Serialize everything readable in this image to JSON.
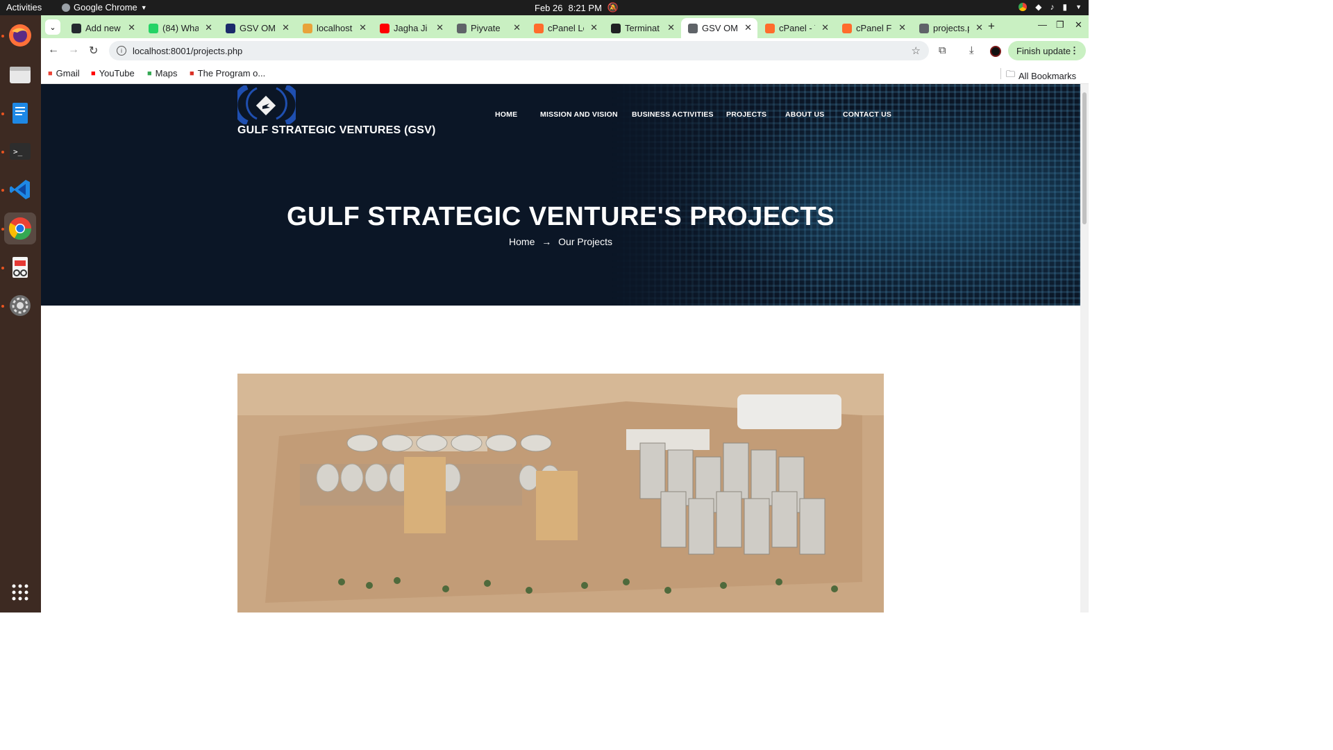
{
  "system_bar": {
    "activities": "Activities",
    "app_name": "Google Chrome",
    "date": "Feb 26",
    "time": "8:21 PM"
  },
  "dock": {
    "items": [
      "firefox-icon",
      "files-icon",
      "text-editor-icon",
      "terminal-icon",
      "vscode-icon",
      "chrome-icon",
      "document-viewer-icon",
      "settings-icon",
      "app-grid-icon"
    ]
  },
  "browser": {
    "tabs": [
      {
        "title": "Add new",
        "icon": "github-icon",
        "color": "#24292f"
      },
      {
        "title": "(84) Wha",
        "icon": "whatsapp-icon",
        "color": "#25d366"
      },
      {
        "title": "GSV OMA",
        "icon": "site-favicon",
        "color": "#1b2a6b"
      },
      {
        "title": "localhost",
        "icon": "localhost-icon",
        "color": "#e8a33b"
      },
      {
        "title": "Jagha Ji L",
        "icon": "youtube-icon",
        "color": "#ff0000"
      },
      {
        "title": "Piyvate",
        "icon": "globe-icon",
        "color": "#5f6368"
      },
      {
        "title": "cPanel Lo",
        "icon": "cpanel-icon",
        "color": "#ff6c2c"
      },
      {
        "title": "Terminat",
        "icon": "openai-icon",
        "color": "#202124"
      },
      {
        "title": "GSV OMA",
        "icon": "globe-icon",
        "color": "#5f6368",
        "active": true
      },
      {
        "title": "cPanel - T",
        "icon": "cpanel-icon",
        "color": "#ff6c2c"
      },
      {
        "title": "cPanel Fil",
        "icon": "cpanel-icon",
        "color": "#ff6c2c"
      },
      {
        "title": "projects.p",
        "icon": "globe-icon",
        "color": "#5f6368"
      }
    ],
    "url": "localhost:8001/projects.php",
    "update_label": "Finish update",
    "bookmarks": [
      {
        "label": "Gmail",
        "icon": "gmail-icon",
        "color": "#ea4335"
      },
      {
        "label": "YouTube",
        "icon": "youtube-icon",
        "color": "#ff0000"
      },
      {
        "label": "Maps",
        "icon": "maps-icon",
        "color": "#34a853"
      },
      {
        "label": "The Program o...",
        "icon": "program-icon",
        "color": "#d93025"
      }
    ],
    "all_bookmarks": "All Bookmarks",
    "accent_color": "#c9f0c2"
  },
  "site": {
    "brand": "GULF STRATEGIC VENTURES (GSV)",
    "nav": [
      "HOME",
      "MISSION AND VISION",
      "BUSINESS ACTIVITIES",
      "PROJECTS",
      "ABOUT US",
      "CONTACT US"
    ],
    "hero_title": "GULF STRATEGIC VENTURE'S PROJECTS",
    "breadcrumb": {
      "home": "Home",
      "current": "Our Projects"
    },
    "hero_bg_color": "#0b1626",
    "logo_color": "#1f4fb0"
  }
}
